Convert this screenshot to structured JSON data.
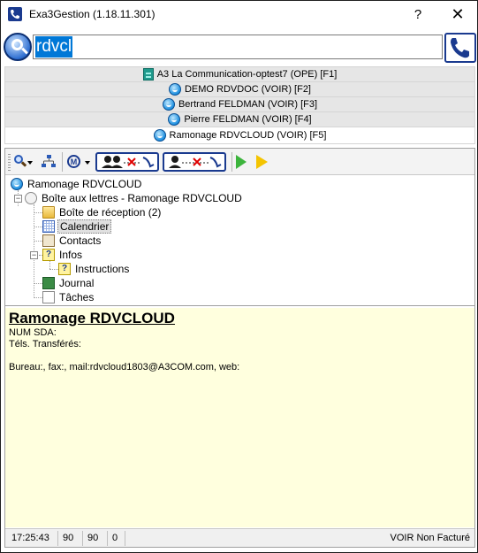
{
  "window": {
    "title": "Exa3Gestion (1.18.11.301)",
    "help_label": "?",
    "close_label": "✕"
  },
  "search": {
    "value": "rdvcl"
  },
  "tabs": [
    {
      "label": "A3 La Communication-optest7 (OPE) [F1]",
      "icon": "building-icon",
      "active": false
    },
    {
      "label": "DEMO RDVDOC (VOIR) [F2]",
      "icon": "contact-bubble-icon",
      "active": false
    },
    {
      "label": "Bertrand FELDMAN (VOIR) [F3]",
      "icon": "contact-bubble-icon",
      "active": false
    },
    {
      "label": "Pierre FELDMAN (VOIR) [F4]",
      "icon": "contact-bubble-icon",
      "active": false
    },
    {
      "label": "Ramonage RDVCLOUD (VOIR) [F5]",
      "icon": "contact-bubble-icon",
      "active": true
    }
  ],
  "tree": {
    "root": "Ramonage RDVCLOUD",
    "mailbox": "Boîte aux lettres - Ramonage RDVCLOUD",
    "inbox": "Boîte de réception (2)",
    "calendar": "Calendrier",
    "contacts": "Contacts",
    "infos": "Infos",
    "instructions": "Instructions",
    "journal": "Journal",
    "tasks": "Tâches",
    "expanded_symbol": "−"
  },
  "details": {
    "title": "Ramonage RDVCLOUD",
    "num_sda": "NUM SDA:",
    "tels": "Téls. Transférés:",
    "contact_line": "Bureau:, fax:, mail:rdvcloud1803@A3COM.com, web:"
  },
  "status": {
    "time": "17:25:43",
    "a": "90",
    "b": "90",
    "c": "0",
    "mode": "VOIR Non Facturé"
  },
  "colors": {
    "accent": "#1a3a8f",
    "details_bg": "#ffffde",
    "selection": "#0078d7"
  }
}
